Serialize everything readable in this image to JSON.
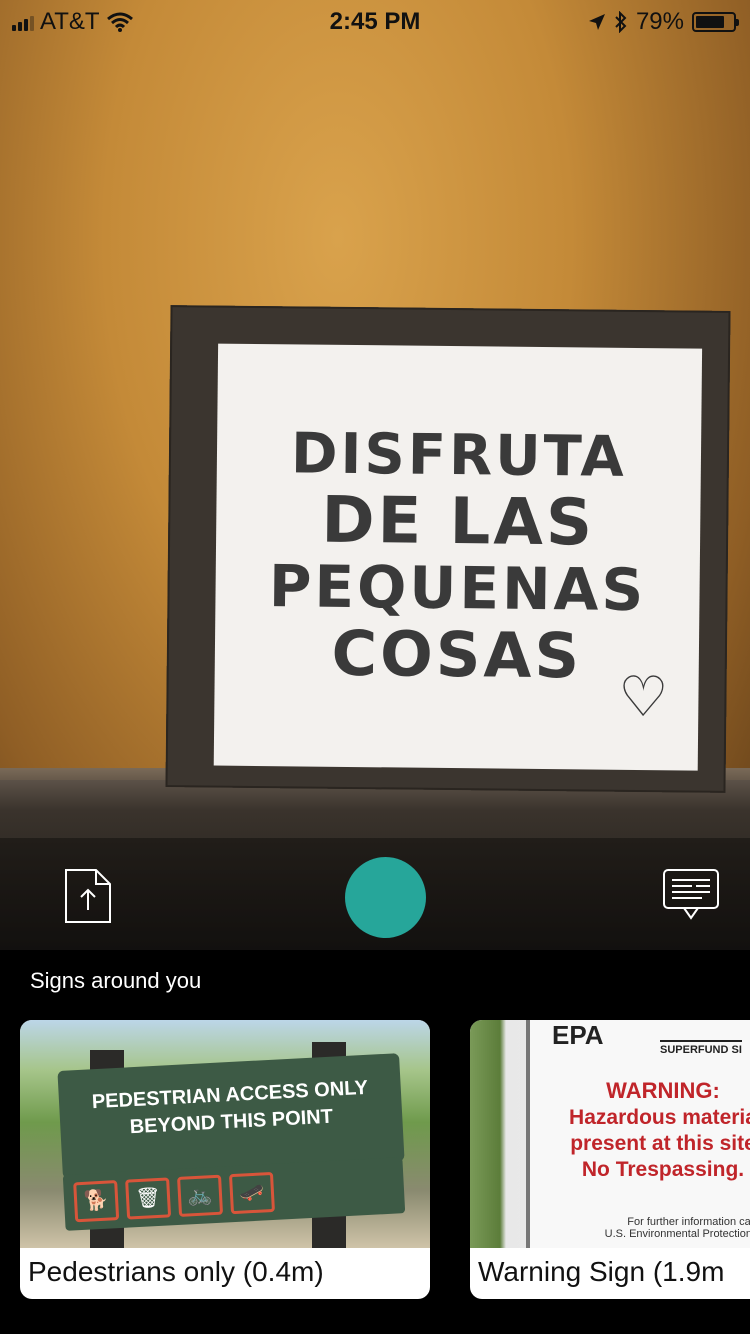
{
  "status_bar": {
    "carrier": "AT&T",
    "time": "2:45 PM",
    "battery_percent": "79%",
    "battery_level": 0.79
  },
  "camera_view": {
    "sign_lines": [
      "DISFRUTA",
      "DE LAS",
      "PEQUENAS",
      "COSAS"
    ],
    "heart_icon": "heart"
  },
  "controls": {
    "upload_icon": "upload-file-icon",
    "shutter_color": "#26a69a",
    "captions_icon": "captions-icon"
  },
  "nearby": {
    "title": "Signs around you",
    "cards": [
      {
        "caption": "Pedestrians only (0.4m)",
        "image_text": [
          "PEDESTRIAN ACCESS ONLY",
          "BEYOND THIS POINT"
        ]
      },
      {
        "caption": "Warning Sign (1.9m",
        "image_text": {
          "logo": "EPA",
          "banner": "SUPERFUND SI",
          "warning": "WARNING:",
          "lines": [
            "Hazardous materia",
            "present at this site",
            "No Trespassing."
          ],
          "footer1": "For further information call the",
          "footer2": "U.S. Environmental Protection Age"
        }
      }
    ]
  }
}
